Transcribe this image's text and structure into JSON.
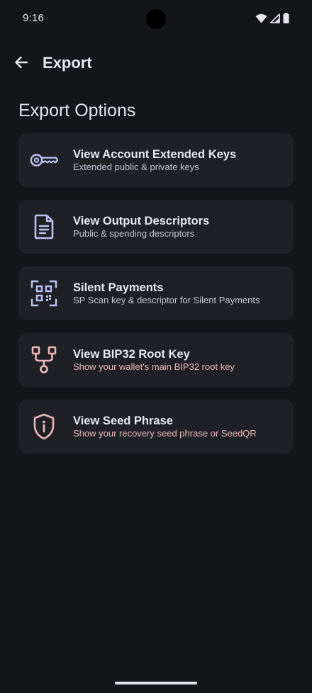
{
  "status_bar": {
    "time": "9:16"
  },
  "app_bar": {
    "title": "Export",
    "back_icon": "arrow-back-icon"
  },
  "section": {
    "title": "Export Options"
  },
  "options": [
    {
      "title": "View Account Extended Keys",
      "subtitle": "Extended public & private keys",
      "icon": "key-icon",
      "color": "#b9c3f5"
    },
    {
      "title": "View Output Descriptors",
      "subtitle": "Public & spending descriptors",
      "icon": "document-icon",
      "color": "#b9c3f5"
    },
    {
      "title": "Silent Payments",
      "subtitle": "SP Scan key & descriptor for Silent Payments",
      "icon": "qr-code-icon",
      "color": "#b9c3f5"
    },
    {
      "title": "View BIP32 Root Key",
      "subtitle": "Show your wallet's main BIP32 root key",
      "icon": "tree-icon",
      "color": "#ecb6b8"
    },
    {
      "title": "View Seed Phrase",
      "subtitle": "Show your recovery seed phrase or SeedQR",
      "icon": "shield-info-icon",
      "color": "#ecb6b8"
    }
  ],
  "colors": {
    "background": "#141519",
    "card": "#1f2026",
    "accent_blue": "#b9c3f5",
    "accent_pink": "#ecb6b8"
  }
}
